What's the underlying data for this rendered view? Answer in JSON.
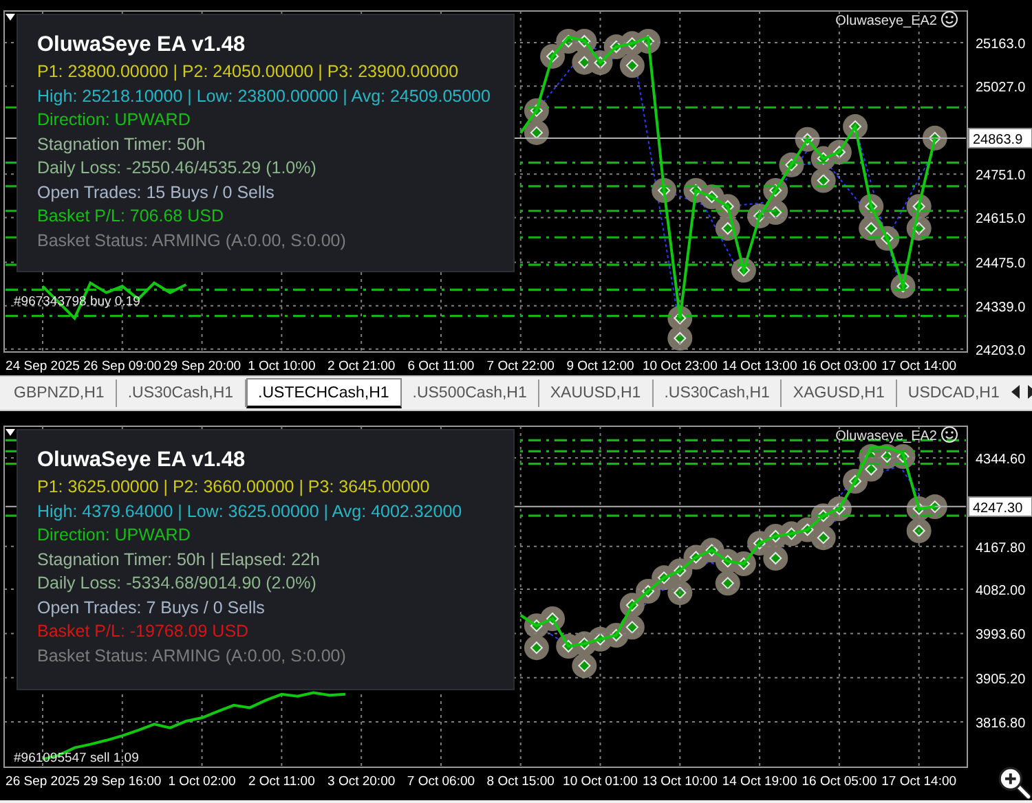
{
  "top_chart": {
    "ea_label": "Oluwaseye_EA2",
    "info_panel": {
      "title": "OluwaSeye EA v1.48",
      "lines": [
        {
          "text": "P1: 23800.00000 | P2: 24050.00000 | P3: 23900.00000",
          "color": "#d2cc10"
        },
        {
          "text": "High: 25218.10000 | Low: 23800.00000 | Avg: 24509.05000",
          "color": "#22b8c8"
        },
        {
          "text": "Direction: UPWARD",
          "color": "#12c012"
        },
        {
          "text": "Stagnation Timer: 50h",
          "color": "#98b898"
        },
        {
          "text": "Daily Loss: -2550.46/4535.29 (1.0%)",
          "color": "#8cb88c"
        },
        {
          "text": "Open Trades: 15 Buys / 0 Sells",
          "color": "#a8b6cc"
        },
        {
          "text": "Basket P/L: 706.68 USD",
          "color": "#12c012"
        },
        {
          "text": "Basket Status: ARMING (A:0.00, S:0.00)",
          "color": "#7c7c7c"
        }
      ]
    },
    "trade_labels": [
      "#967343798 buy 0.19"
    ],
    "chart_data": {
      "type": "line",
      "grid": true,
      "categories": [
        "24 Sep 2025",
        null,
        null,
        null,
        null,
        "26 Sep 09:00",
        null,
        null,
        null,
        null,
        "29 Sep 20:00",
        null,
        null,
        null,
        null,
        "1 Oct 10:00",
        null,
        null,
        null,
        null,
        "2 Oct 21:00",
        null,
        null,
        null,
        null,
        "6 Oct 11:00",
        null,
        null,
        null,
        null,
        "7 Oct 22:00",
        null,
        null,
        null,
        null,
        "9 Oct 12:00",
        null,
        null,
        null,
        null,
        "10 Oct 23:00",
        null,
        null,
        null,
        null,
        "14 Oct 13:00",
        null,
        null,
        null,
        null,
        "16 Oct 03:00",
        null,
        null,
        null,
        null,
        "17 Oct 14:00",
        null
      ],
      "ylim": [
        24194,
        25262
      ],
      "series": [
        {
          "color": "#10c810",
          "values": [
            24400,
            24350,
            24300,
            24410,
            24380,
            24400,
            24360,
            24410,
            24380,
            24405,
            null,
            null,
            null,
            null,
            null,
            null,
            null,
            null,
            null,
            null,
            null,
            null,
            null,
            null,
            null,
            null,
            null,
            null,
            null,
            null,
            24880,
            24950,
            25120,
            25180,
            25170,
            25100,
            25150,
            25160,
            25180,
            24700,
            24300,
            24700,
            24680,
            24650,
            24450,
            24620,
            24700,
            24780,
            24860,
            24800,
            24820,
            24900,
            24650,
            24550,
            24400,
            24650,
            24864
          ]
        }
      ],
      "yticks": [
        {
          "value": 25163,
          "label": "25163.0"
        },
        {
          "value": 25027,
          "label": "25027.0"
        },
        {
          "value": 24751,
          "label": "24751.0"
        },
        {
          "value": 24615,
          "label": "24615.0"
        },
        {
          "value": 24475,
          "label": "24475.0"
        },
        {
          "value": 24339,
          "label": "24339.0"
        },
        {
          "value": 24203,
          "label": "24203.0"
        }
      ],
      "ref_lines": [
        {
          "axis": "y",
          "value": 24960,
          "color": "#14b414"
        },
        {
          "axis": "y",
          "value": 24787,
          "color": "#14b414"
        },
        {
          "axis": "y",
          "value": 24713,
          "color": "#14b414"
        },
        {
          "axis": "y",
          "value": 24636,
          "color": "#14b414"
        },
        {
          "axis": "y",
          "value": 24553,
          "color": "#14b414"
        },
        {
          "axis": "y",
          "value": 24467,
          "color": "#14b414"
        },
        {
          "axis": "y",
          "value": 24389,
          "color": "#14b414"
        },
        {
          "axis": "y",
          "value": 24307,
          "color": "#14b414"
        },
        {
          "axis": "y",
          "value": 24863.9,
          "color": "#b0b0b0",
          "label": "24863.9"
        }
      ]
    }
  },
  "tabs": [
    {
      "label": "GBPNZD,H1",
      "selected": false
    },
    {
      "label": ".US30Cash,H1",
      "selected": false
    },
    {
      "label": ".USTECHCash,H1",
      "selected": true
    },
    {
      "label": ".US500Cash,H1",
      "selected": false
    },
    {
      "label": "XAUUSD,H1",
      "selected": false
    },
    {
      "label": ".US30Cash,H1",
      "selected": false
    },
    {
      "label": "XAGUSD,H1",
      "selected": false
    },
    {
      "label": "USDCAD,H1",
      "selected": false
    }
  ],
  "bottom_chart": {
    "ea_label": "Oluwaseye_EA2",
    "info_panel": {
      "title": "OluwaSeye EA v1.48",
      "lines": [
        {
          "text": "P1: 3625.00000 | P2: 3660.00000 | P3: 3645.00000",
          "color": "#d2cc10"
        },
        {
          "text": "High: 4379.64000 | Low: 3625.00000 | Avg: 4002.32000",
          "color": "#22b8c8"
        },
        {
          "text": "Direction: UPWARD",
          "color": "#12c012"
        },
        {
          "text": "Stagnation Timer: 50h | Elapsed: 22h",
          "color": "#98b898"
        },
        {
          "text": "Daily Loss: -5334.68/9014.90 (2.0%)",
          "color": "#8cb88c"
        },
        {
          "text": "Open Trades: 7 Buys / 0 Sells",
          "color": "#a8b6cc"
        },
        {
          "text": "Basket P/L: -19768.09 USD",
          "color": "#d81414"
        },
        {
          "text": "Basket Status: ARMING (A:0.00, S:0.00)",
          "color": "#7c7c7c"
        }
      ]
    },
    "trade_labels": [
      "#961095547 sell 1.09"
    ],
    "chart_data": {
      "type": "line",
      "grid": true,
      "categories": [
        "26 Sep 2025",
        null,
        null,
        null,
        null,
        "29 Sep 16:00",
        null,
        null,
        null,
        null,
        "1 Oct 02:00",
        null,
        null,
        null,
        null,
        "2 Oct 11:00",
        null,
        null,
        null,
        null,
        "3 Oct 20:00",
        null,
        null,
        null,
        null,
        "7 Oct 06:00",
        null,
        null,
        null,
        null,
        "8 Oct 15:00",
        null,
        null,
        null,
        null,
        "10 Oct 01:00",
        null,
        null,
        null,
        null,
        "13 Oct 10:00",
        null,
        null,
        null,
        null,
        "14 Oct 19:00",
        null,
        null,
        null,
        null,
        "16 Oct 05:00",
        null,
        null,
        null,
        null,
        "17 Oct 14:00",
        null
      ],
      "ylim": [
        3726,
        4408
      ],
      "series": [
        {
          "color": "#10c810",
          "values": [
            3742,
            3750,
            3765,
            3772,
            3780,
            3789,
            3800,
            3812,
            3805,
            3818,
            3825,
            3838,
            3850,
            3845,
            3860,
            3872,
            3868,
            3875,
            3870,
            3872,
            null,
            null,
            null,
            null,
            null,
            null,
            null,
            null,
            null,
            null,
            4030,
            4009,
            4023,
            3968,
            3973,
            3982,
            3990,
            4050,
            4078,
            4105,
            4119,
            4146,
            4160,
            4138,
            4133,
            4174,
            4188,
            4193,
            4201,
            4229,
            4243,
            4298,
            4366,
            4366,
            4353,
            4243,
            4247
          ]
        }
      ],
      "yticks": [
        {
          "value": 4344.6,
          "label": "4344.60"
        },
        {
          "value": 4167.8,
          "label": "4167.80"
        },
        {
          "value": 4082,
          "label": "4082.00"
        },
        {
          "value": 3993.6,
          "label": "3993.60"
        },
        {
          "value": 3905.2,
          "label": "3905.20"
        },
        {
          "value": 3816.8,
          "label": "3816.80"
        }
      ],
      "ref_lines": [
        {
          "axis": "y",
          "value": 4380,
          "color": "#14b414"
        },
        {
          "axis": "y",
          "value": 4358,
          "color": "#14b414"
        },
        {
          "axis": "y",
          "value": 4333,
          "color": "#14b414"
        },
        {
          "axis": "y",
          "value": 4229,
          "color": "#14b414"
        },
        {
          "axis": "y",
          "value": 4247.3,
          "color": "#b0b0b0",
          "label": "4247.30"
        }
      ]
    }
  }
}
